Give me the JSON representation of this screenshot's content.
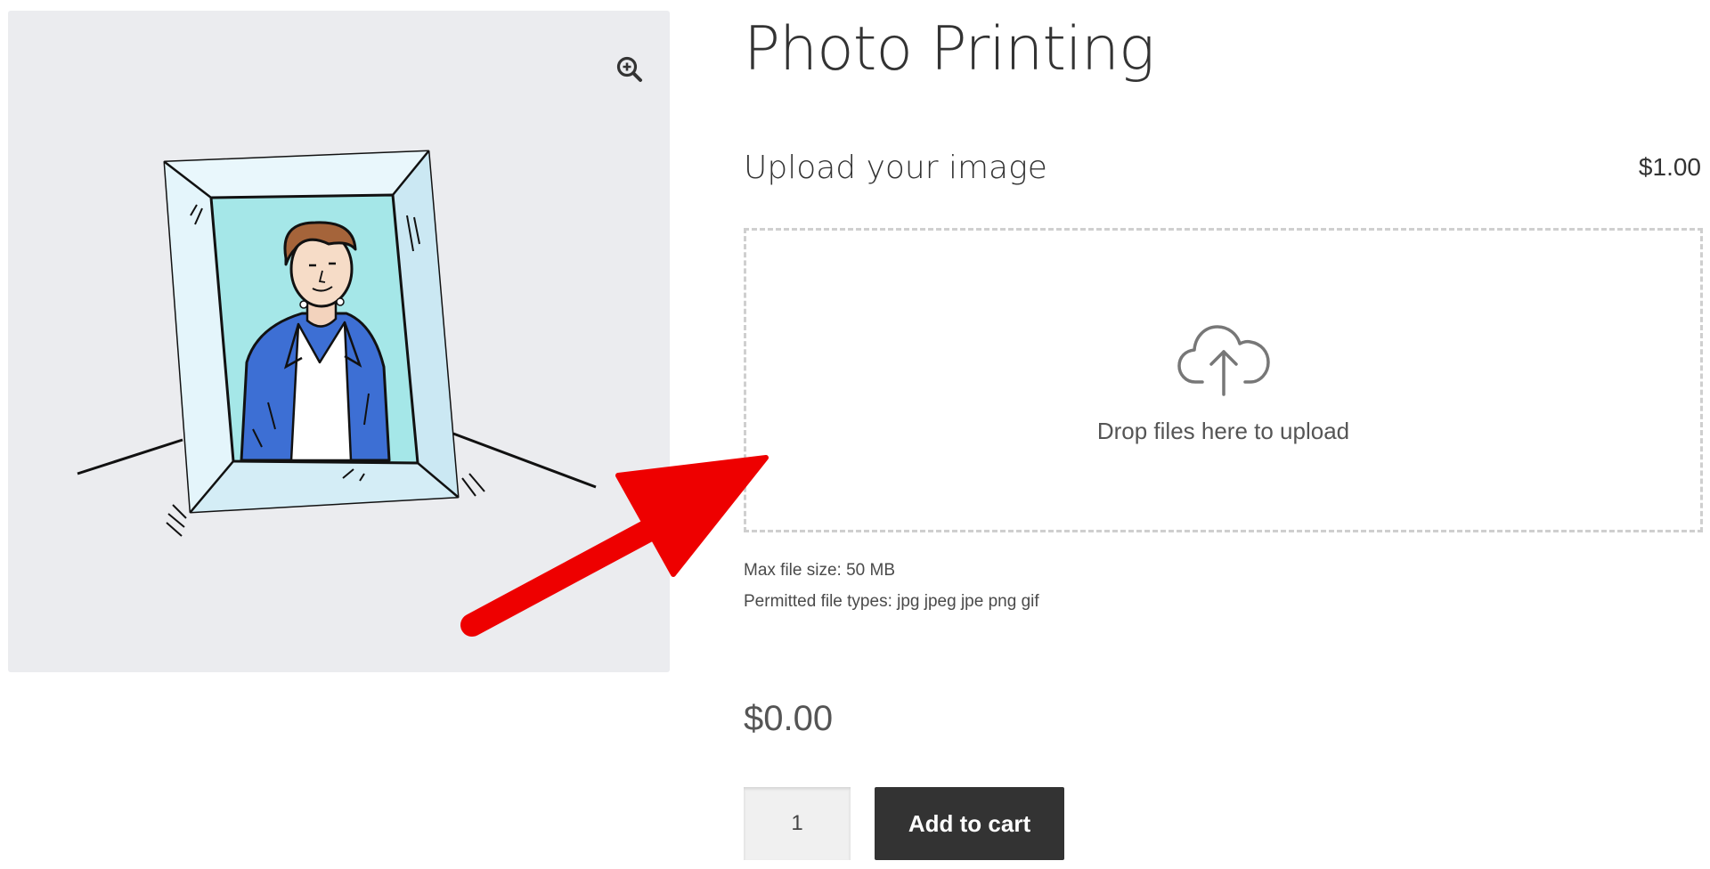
{
  "product": {
    "title": "Photo Printing",
    "total_price": "$0.00"
  },
  "gallery": {
    "zoom_icon": "zoom-in-icon",
    "image_subject": "framed-portrait-illustration"
  },
  "upload_field": {
    "label": "Upload your image",
    "price": "$1.00",
    "dropzone_text": "Drop files here to upload",
    "dropzone_icon": "cloud-upload-icon",
    "max_file_size": "Max file size: 50 MB",
    "permitted_types": "Permitted file types: jpg jpeg jpe png gif"
  },
  "cart": {
    "quantity": "1",
    "add_to_cart_label": "Add to cart"
  },
  "colors": {
    "button_bg": "#333333",
    "gallery_bg": "#ebecef",
    "dropzone_border": "#cfcfcf",
    "annotation_arrow": "#ee0000"
  }
}
